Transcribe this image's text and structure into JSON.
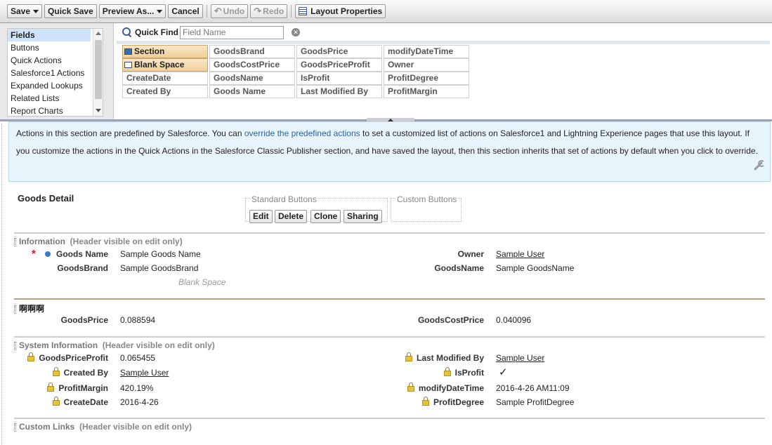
{
  "toolbar": {
    "save": "Save",
    "quick_save": "Quick Save",
    "preview_as": "Preview As...",
    "cancel": "Cancel",
    "undo": "Undo",
    "redo": "Redo",
    "layout_properties": "Layout Properties"
  },
  "palette": {
    "categories": [
      "Fields",
      "Buttons",
      "Quick Actions",
      "Salesforce1 Actions",
      "Expanded Lookups",
      "Related Lists",
      "Report Charts"
    ],
    "selected_category": "Fields",
    "quick_find_label": "Quick Find",
    "quick_find_placeholder": "Field Name",
    "fields": [
      [
        "Section",
        "GoodsBrand",
        "GoodsPrice",
        "modifyDateTime"
      ],
      [
        "Blank Space",
        "GoodsCostPrice",
        "GoodsPriceProfit",
        "Owner"
      ],
      [
        "CreateDate",
        "GoodsName",
        "IsProfit",
        "ProfitDegree"
      ],
      [
        "Created By",
        "Goods Name",
        "Last Modified By",
        "ProfitMargin"
      ]
    ]
  },
  "notice": {
    "before_link": "Actions in this section are predefined by Salesforce. You can ",
    "link": "override the predefined actions",
    "after_link": " to set a customized list of actions on Salesforce1 and Lightning Experience pages that use this layout. If you customize the actions in the Quick Actions in the Salesforce Classic Publisher section, and have saved the layout, then this section inherits that set of actions by default when you click to override."
  },
  "detail": {
    "title": "Goods Detail",
    "standard_buttons_label": "Standard Buttons",
    "custom_buttons_label": "Custom Buttons",
    "buttons": [
      "Edit",
      "Delete",
      "Clone",
      "Sharing"
    ]
  },
  "sections": {
    "information": {
      "title": "Information",
      "hint": "(Header visible on edit only)",
      "left": [
        {
          "label": "Goods Name",
          "value": "Sample Goods Name"
        },
        {
          "label": "GoodsBrand",
          "value": "Sample GoodsBrand"
        }
      ],
      "blank_space": "Blank Space",
      "right": [
        {
          "label": "Owner",
          "value": "Sample User"
        },
        {
          "label": "GoodsName",
          "value": "Sample GoodsName"
        }
      ]
    },
    "custom": {
      "title": "啊啊啊",
      "left": [
        {
          "label": "GoodsPrice",
          "value": "0.088594"
        }
      ],
      "right": [
        {
          "label": "GoodsCostPrice",
          "value": "0.040096"
        }
      ]
    },
    "system": {
      "title": "System Information",
      "hint": "(Header visible on edit only)",
      "left": [
        {
          "label": "GoodsPriceProfit",
          "value": "0.065455"
        },
        {
          "label": "Created By",
          "value": "Sample User"
        },
        {
          "label": "ProfitMargin",
          "value": "420.19%"
        },
        {
          "label": "CreateDate",
          "value": "2016-4-26"
        }
      ],
      "right": [
        {
          "label": "Last Modified By",
          "value": "Sample User"
        },
        {
          "label": "IsProfit",
          "value": "✓"
        },
        {
          "label": "modifyDateTime",
          "value": "2016-4-26 AM11:09"
        },
        {
          "label": "ProfitDegree",
          "value": "Sample ProfitDegree"
        }
      ]
    },
    "custom_links": {
      "title": "Custom Links",
      "hint": "(Header visible on edit only)"
    }
  },
  "colors": {
    "accent_link": "#2a61a8",
    "notice_bg": "#e8f4fb",
    "required": "#d01818"
  }
}
